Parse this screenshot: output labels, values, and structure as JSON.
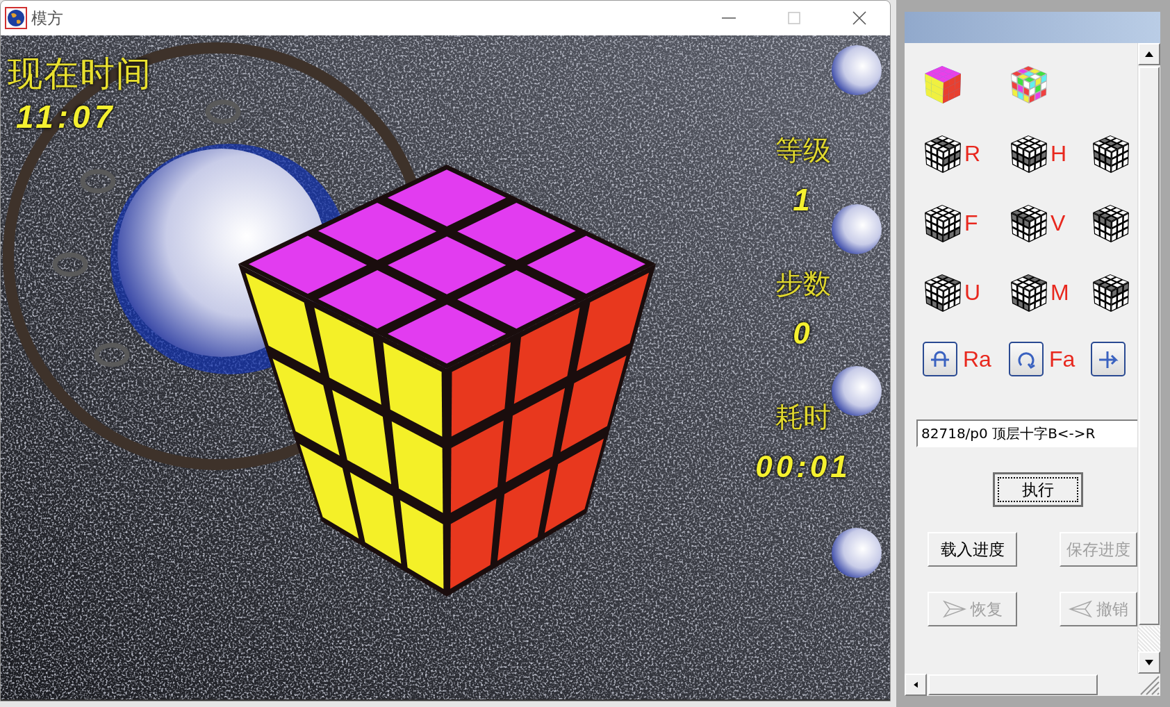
{
  "window": {
    "title": "模方",
    "controls": [
      {
        "kind": "minimize",
        "disabled": false
      },
      {
        "kind": "maximize",
        "disabled": true
      },
      {
        "kind": "close",
        "disabled": false
      }
    ]
  },
  "game": {
    "clock_label": "现在时间",
    "clock": "11:07",
    "stats": [
      {
        "label": "等级",
        "value": "1"
      },
      {
        "label": "步数",
        "value": "0"
      },
      {
        "label": "耗时",
        "value": "00:01"
      }
    ]
  },
  "panel": {
    "tool_rows": [
      [
        {
          "kind": "solved"
        },
        {
          "kind": "mixed"
        }
      ],
      [
        {
          "kind": "slice",
          "label": "R"
        },
        {
          "kind": "slice",
          "label": "H"
        },
        {
          "kind": "slice"
        }
      ],
      [
        {
          "kind": "slice",
          "label": "F"
        },
        {
          "kind": "slice",
          "label": "V"
        },
        {
          "kind": "slice"
        }
      ],
      [
        {
          "kind": "slice",
          "label": "U"
        },
        {
          "kind": "slice",
          "label": "M"
        },
        {
          "kind": "slice"
        }
      ],
      [
        {
          "kind": "button",
          "label": "Ra"
        },
        {
          "kind": "button",
          "label": "Fa"
        },
        {
          "kind": "button"
        }
      ]
    ],
    "command": {
      "value": "82718/p0 顶层十字B<->R"
    },
    "execute": {
      "label": "执行",
      "focused": true,
      "disabled": false
    },
    "buttons": [
      {
        "label": "载入进度",
        "kind": "plain",
        "disabled": false
      },
      {
        "label": "保存进度",
        "kind": "plain",
        "disabled": true
      },
      {
        "label": "恢复",
        "kind": "forward",
        "disabled": true
      },
      {
        "label": "撤销",
        "kind": "back",
        "disabled": true
      }
    ]
  }
}
